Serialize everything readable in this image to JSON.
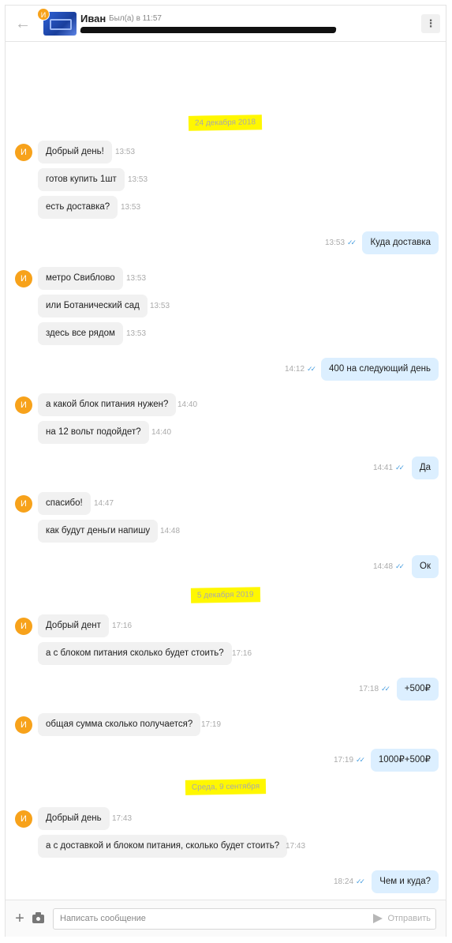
{
  "header": {
    "back_icon": "arrow-left-icon",
    "avatar_letter": "И",
    "contact_name": "Иван",
    "last_seen": "Был(а) в 11:57",
    "menu_icon": "more-vertical-icon"
  },
  "chat": {
    "dates": [
      "24 декабря 2018",
      "5 декабря 2019",
      "Среда, 9 сентября"
    ],
    "messages": [
      {
        "text": "Добрый день!",
        "time": "13:53"
      },
      {
        "text": "готов купить 1шт",
        "time": "13:53"
      },
      {
        "text": "есть доставка?",
        "time": "13:53"
      },
      {
        "text": "Куда доставка",
        "time": "13:53"
      },
      {
        "text": "метро Свиблово",
        "time": "13:53"
      },
      {
        "text": "или Ботанический сад",
        "time": "13:53"
      },
      {
        "text": "здесь все рядом",
        "time": "13:53"
      },
      {
        "text": "400 на следующий день",
        "time": "14:12"
      },
      {
        "text": "а какой блок питания нужен?",
        "time": "14:40"
      },
      {
        "text": "на 12 вольт подойдет?",
        "time": "14:40"
      },
      {
        "text": "Да",
        "time": "14:41"
      },
      {
        "text": "спасибо!",
        "time": "14:47"
      },
      {
        "text": "как будут деньги напишу",
        "time": "14:48"
      },
      {
        "text": "Ок",
        "time": "14:48"
      },
      {
        "text": "Добрый дент",
        "time": "17:16"
      },
      {
        "text": "а с блоком питания сколько будет стоить?",
        "time": "17:16"
      },
      {
        "text": "+500₽",
        "time": "17:18"
      },
      {
        "text": "общая сумма сколько получается?",
        "time": "17:19"
      },
      {
        "text": "1000₽+500₽",
        "time": "17:19"
      },
      {
        "text": "Добрый день",
        "time": "17:43"
      },
      {
        "text": "а с доставкой и блоком питания, сколько будет стоить?",
        "time": "17:43"
      },
      {
        "text": "Чем и куда?",
        "time": "18:24"
      }
    ]
  },
  "composer": {
    "placeholder": "Написать сообщение",
    "send_label": "Отправить",
    "plus_icon": "plus-icon",
    "camera_icon": "camera-icon",
    "send_icon": "send-arrow-icon"
  },
  "colors": {
    "avatar": "#f7a21b",
    "outgoing_bubble": "#dcefff",
    "incoming_bubble": "#f1f1f1",
    "date_highlight": "#fff700",
    "read_check": "#4a9fe0"
  }
}
